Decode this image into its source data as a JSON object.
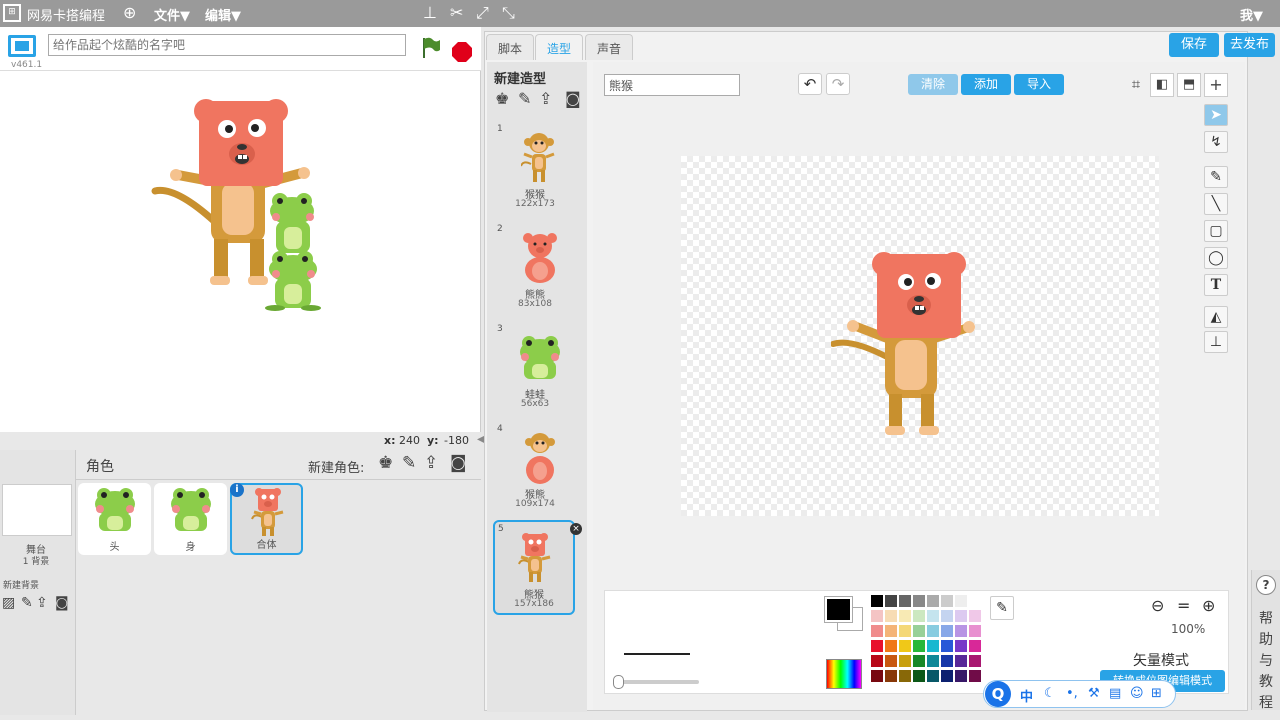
{
  "menubar": {
    "app_name": "网易卡搭编程",
    "file_menu": "文件▼",
    "edit_menu": "编辑▼",
    "user_menu": "我▼"
  },
  "stage": {
    "version": "v461.1",
    "title_placeholder": "给作品起个炫酷的名字吧",
    "coord_x_label": "x:",
    "coord_x": "240",
    "coord_y_label": "y:",
    "coord_y": "-180"
  },
  "sprites": {
    "header": "角色",
    "new_sprite_label": "新建角色:",
    "stage_label": "舞台",
    "stage_backdrops": "1 背景",
    "new_backdrop_label": "新建背景",
    "items": [
      {
        "name": "头"
      },
      {
        "name": "身"
      },
      {
        "name": "合体"
      }
    ]
  },
  "tabs": {
    "scripts": "脚本",
    "costumes": "造型",
    "sounds": "声音"
  },
  "actions": {
    "save": "保存",
    "publish": "去发布"
  },
  "costumes": {
    "new_costume_label": "新建造型",
    "items": [
      {
        "num": "1",
        "name": "猴猴",
        "size": "122x173"
      },
      {
        "num": "2",
        "name": "熊熊",
        "size": "83x108"
      },
      {
        "num": "3",
        "name": "蛙蛙",
        "size": "56x63"
      },
      {
        "num": "4",
        "name": "猴熊",
        "size": "109x174"
      },
      {
        "num": "5",
        "name": "熊猴",
        "size": "157x186"
      }
    ]
  },
  "editor": {
    "costume_name": "熊猴",
    "clear": "清除",
    "add": "添加",
    "import": "导入",
    "zoom": "100%",
    "mode_label": "矢量模式",
    "convert_button": "转换成位图编辑模式"
  },
  "help": {
    "text": "帮助与教程"
  },
  "ime": {
    "lang": "中"
  },
  "colors": {
    "accent": "#29a3e6",
    "menubar": "#9a9a9a",
    "monkey_face": "#f07560",
    "monkey_body": "#d49a3b",
    "frog": "#8ccd4a"
  }
}
